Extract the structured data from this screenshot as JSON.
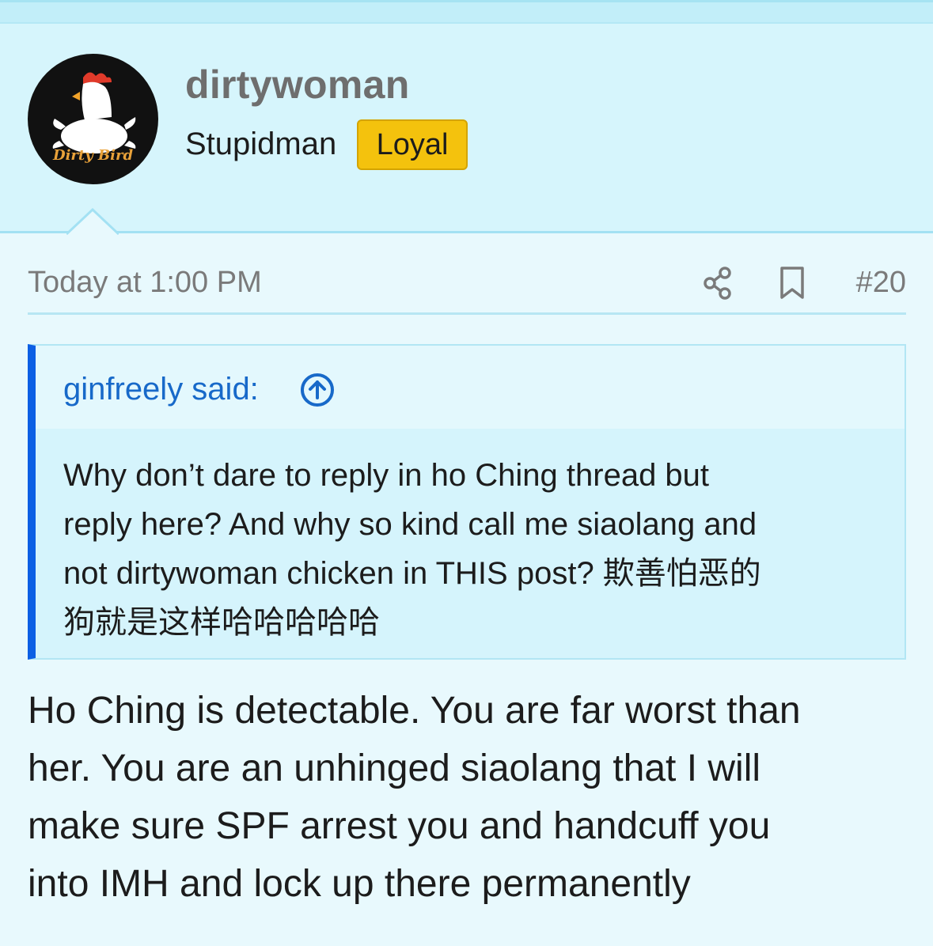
{
  "post": {
    "author": {
      "username": "dirtywoman",
      "title": "Stupidman",
      "badge": "Loyal",
      "avatar_text": "Dirty Bird"
    },
    "meta": {
      "time": "Today at 1:00 PM",
      "share_icon": "share-icon",
      "bookmark_icon": "bookmark-icon",
      "number": "#20"
    },
    "quote": {
      "author_label": "ginfreely said:",
      "jump_icon": "arrow-up-circle-icon",
      "text": "Why don’t dare to reply in ho Ching thread but\nreply here? And why so kind call me siaolang and\nnot dirtywoman chicken in THIS post? 欺善怕恶的\n狗就是这样哈哈哈哈哈"
    },
    "body": "Ho Ching is detectable. You are far worst than\nher. You are an unhinged siaolang that I will\nmake sure SPF arrest you and handcuff you\ninto IMH and lock up there permanently"
  },
  "colors": {
    "header_bg": "#d6f5fc",
    "page_bg": "#e8f9fd",
    "badge": "#f4c20d",
    "quote_accent": "#0b5fe4",
    "link": "#1769c9"
  }
}
